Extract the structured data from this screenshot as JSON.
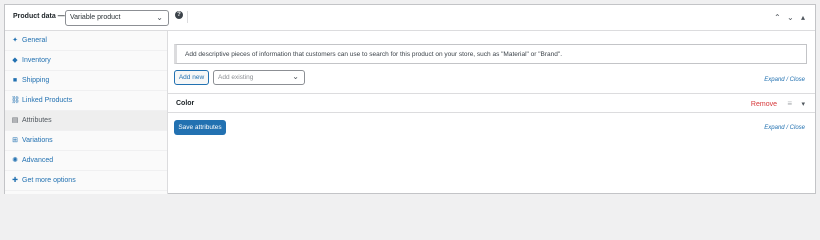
{
  "header": {
    "title": "Product data —",
    "product_type": "Variable product",
    "help_glyph": "?",
    "move_up": "⌃",
    "move_down": "⌄",
    "collapse": "▴"
  },
  "sidebar": {
    "items": [
      {
        "label": "General",
        "icon": "wrench-icon",
        "glyph": "✦"
      },
      {
        "label": "Inventory",
        "icon": "tag-icon",
        "glyph": "◆"
      },
      {
        "label": "Shipping",
        "icon": "truck-icon",
        "glyph": "■"
      },
      {
        "label": "Linked Products",
        "icon": "link-icon",
        "glyph": "⛓"
      },
      {
        "label": "Attributes",
        "icon": "list-icon",
        "glyph": "▤",
        "active": true
      },
      {
        "label": "Variations",
        "icon": "grid-icon",
        "glyph": "⊞"
      },
      {
        "label": "Advanced",
        "icon": "gear-icon",
        "glyph": "✺"
      },
      {
        "label": "Get more options",
        "icon": "plugin-icon",
        "glyph": "✚"
      }
    ]
  },
  "main": {
    "notice": "Add descriptive pieces of information that customers can use to search for this product on your store, such as \"Material\" or \"Brand\".",
    "add_new_label": "Add new",
    "add_existing_placeholder": "Add existing",
    "expand_close": "Expand / Close",
    "attribute": {
      "name": "Color",
      "remove_label": "Remove",
      "drag_glyph": "≡",
      "toggle_glyph": "▾"
    },
    "save_label": "Save attributes",
    "chevron": "⌄"
  },
  "colors": {
    "accent": "#2271b1",
    "danger": "#d63638",
    "border": "#c3c4c7"
  }
}
